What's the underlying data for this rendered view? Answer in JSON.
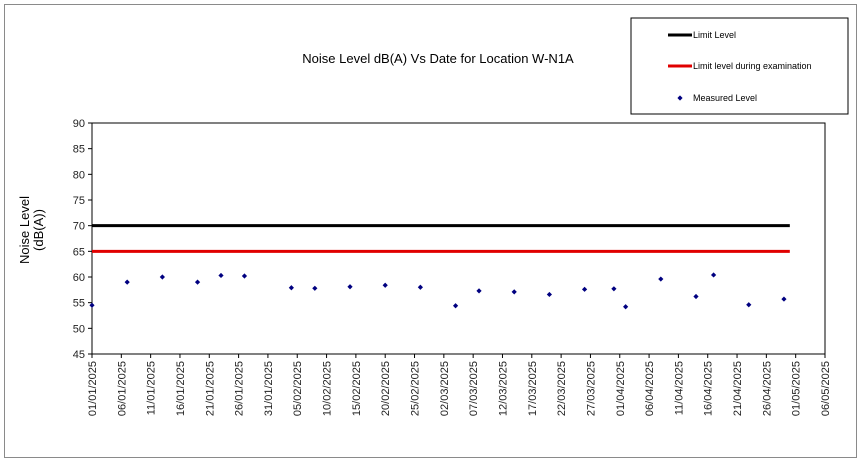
{
  "chart_data": {
    "type": "scatter",
    "title": "Noise Level dB(A) Vs Date for Location W-N1A",
    "ylabel_lines": [
      "Noise Level",
      "(dB(A))"
    ],
    "xlabel": "",
    "ylim": [
      45,
      90
    ],
    "ytick_step": 5,
    "yticks": [
      "45",
      "50",
      "55",
      "60",
      "65",
      "70",
      "75",
      "80",
      "85",
      "90"
    ],
    "xlim": [
      "2025-01-01",
      "2025-05-06"
    ],
    "xticks": [
      "01/01/2025",
      "06/01/2025",
      "11/01/2025",
      "16/01/2025",
      "21/01/2025",
      "26/01/2025",
      "31/01/2025",
      "05/02/2025",
      "10/02/2025",
      "15/02/2025",
      "20/02/2025",
      "25/02/2025",
      "02/03/2025",
      "07/03/2025",
      "12/03/2025",
      "17/03/2025",
      "22/03/2025",
      "27/03/2025",
      "01/04/2025",
      "06/04/2025",
      "11/04/2025",
      "16/04/2025",
      "21/04/2025",
      "26/04/2025",
      "01/05/2025",
      "06/05/2025"
    ],
    "grid": false,
    "legend_position": "top-right",
    "series": [
      {
        "name": "Limit Level",
        "kind": "line",
        "color": "#000000",
        "x": [
          "2025-01-01",
          "2025-04-30"
        ],
        "y": [
          70,
          70
        ]
      },
      {
        "name": "Limit level during examination",
        "kind": "line",
        "color": "#e00000",
        "x": [
          "2025-01-01",
          "2025-04-30"
        ],
        "y": [
          65,
          65
        ]
      },
      {
        "name": "Measured Level",
        "kind": "scatter",
        "color": "#000080",
        "x": [
          "2025-01-01",
          "2025-01-07",
          "2025-01-13",
          "2025-01-19",
          "2025-01-23",
          "2025-01-27",
          "2025-02-04",
          "2025-02-08",
          "2025-02-14",
          "2025-02-20",
          "2025-02-26",
          "2025-03-04",
          "2025-03-08",
          "2025-03-14",
          "2025-03-20",
          "2025-03-26",
          "2025-03-31",
          "2025-04-02",
          "2025-04-08",
          "2025-04-14",
          "2025-04-17",
          "2025-04-23",
          "2025-04-29"
        ],
        "y": [
          54.5,
          59.0,
          60.0,
          59.0,
          60.3,
          60.2,
          57.9,
          57.8,
          58.1,
          58.4,
          58.0,
          54.4,
          57.3,
          57.1,
          56.6,
          57.6,
          57.7,
          54.2,
          59.6,
          56.2,
          60.4,
          54.6,
          55.7
        ]
      }
    ]
  }
}
